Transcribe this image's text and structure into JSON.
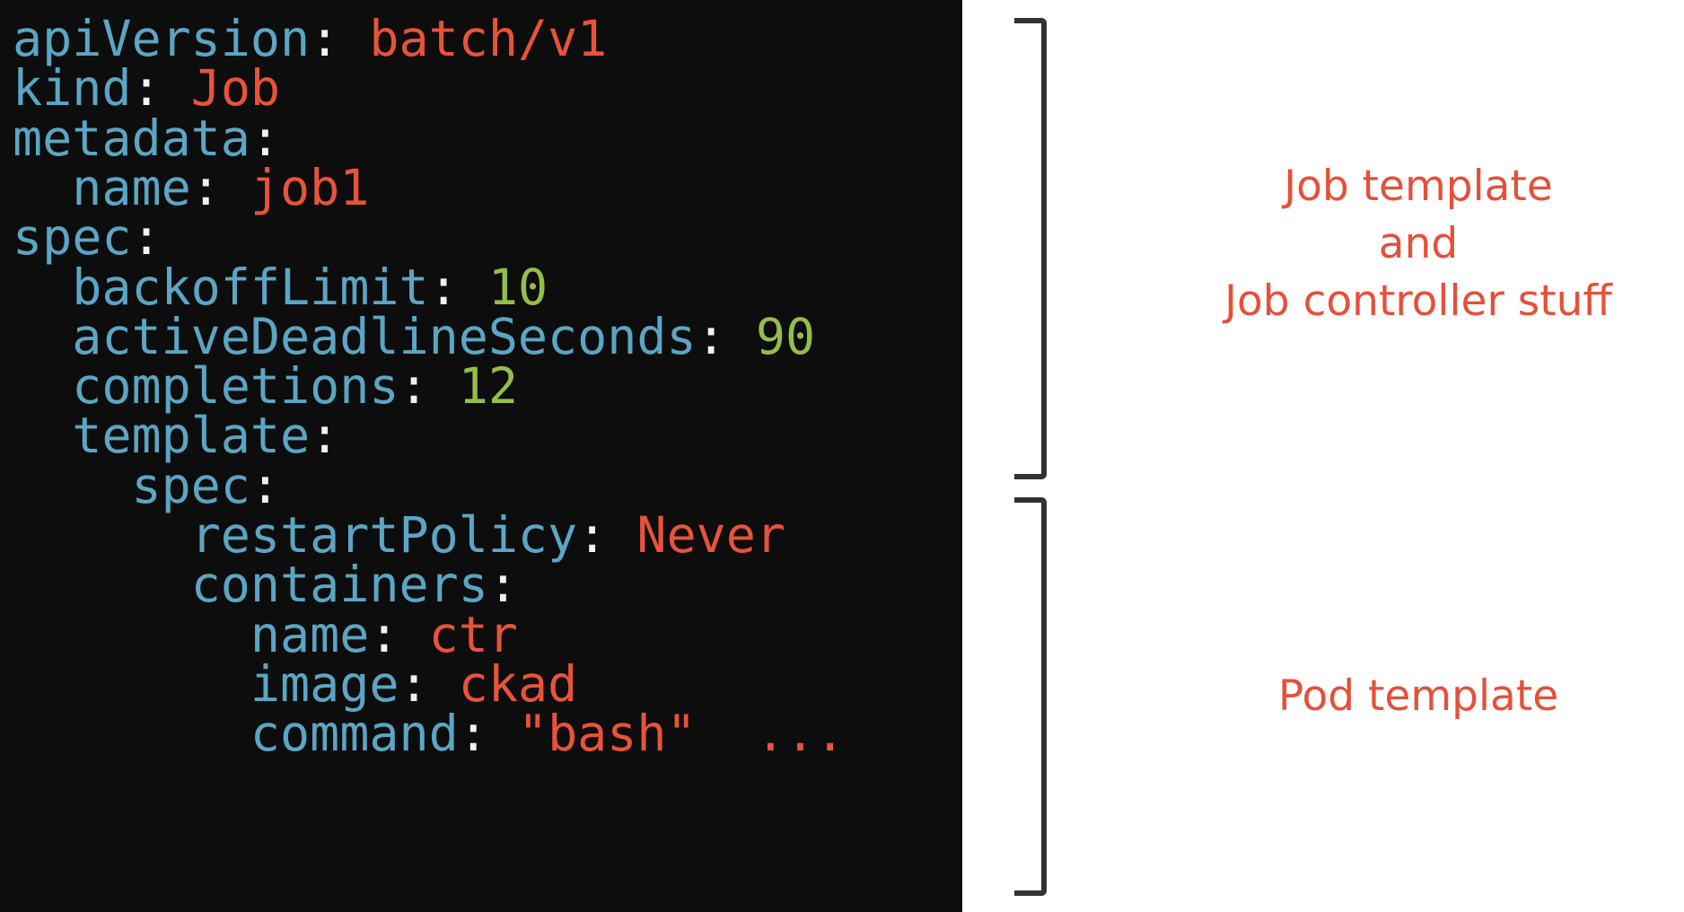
{
  "code": {
    "lines": [
      {
        "indent": "",
        "key": "apiVersion",
        "colon": ":",
        "sep": " ",
        "value": "batch/v1",
        "value_type": "string",
        "trail": ""
      },
      {
        "indent": "",
        "key": "kind",
        "colon": ":",
        "sep": " ",
        "value": "Job",
        "value_type": "string",
        "trail": ""
      },
      {
        "indent": "",
        "key": "metadata",
        "colon": ":",
        "sep": "",
        "value": "",
        "value_type": "none",
        "trail": ""
      },
      {
        "indent": "  ",
        "key": "name",
        "colon": ":",
        "sep": " ",
        "value": "job1",
        "value_type": "string",
        "trail": ""
      },
      {
        "indent": "",
        "key": "spec",
        "colon": ":",
        "sep": "",
        "value": "",
        "value_type": "none",
        "trail": ""
      },
      {
        "indent": "  ",
        "key": "backoffLimit",
        "colon": ":",
        "sep": " ",
        "value": "10",
        "value_type": "number",
        "trail": ""
      },
      {
        "indent": "  ",
        "key": "activeDeadlineSeconds",
        "colon": ":",
        "sep": " ",
        "value": "90",
        "value_type": "number",
        "trail": ""
      },
      {
        "indent": "  ",
        "key": "completions",
        "colon": ":",
        "sep": " ",
        "value": "12",
        "value_type": "number",
        "trail": ""
      },
      {
        "indent": "  ",
        "key": "template",
        "colon": ":",
        "sep": "",
        "value": "",
        "value_type": "none",
        "trail": ""
      },
      {
        "indent": "    ",
        "key": "spec",
        "colon": ":",
        "sep": "",
        "value": "",
        "value_type": "none",
        "trail": ""
      },
      {
        "indent": "      ",
        "key": "restartPolicy",
        "colon": ":",
        "sep": " ",
        "value": "Never",
        "value_type": "string",
        "trail": ""
      },
      {
        "indent": "      ",
        "key": "containers",
        "colon": ":",
        "sep": "",
        "value": "",
        "value_type": "none",
        "trail": ""
      },
      {
        "indent": "        ",
        "key": "name",
        "colon": ":",
        "sep": " ",
        "value": "ctr",
        "value_type": "string",
        "trail": ""
      },
      {
        "indent": "        ",
        "key": "image",
        "colon": ":",
        "sep": " ",
        "value": "ckad",
        "value_type": "string",
        "trail": ""
      },
      {
        "indent": "        ",
        "key": "command",
        "colon": ":",
        "sep": " ",
        "value": "\"bash\"",
        "value_type": "string",
        "trail": "  ..."
      }
    ]
  },
  "annotations": {
    "job": {
      "lines": [
        "Job template",
        "and",
        "Job controller stuff"
      ]
    },
    "pod": {
      "lines": [
        "Pod template"
      ]
    }
  },
  "colors": {
    "background_code": "#0d0d0d",
    "key": "#5aa6c4",
    "punctuation": "#f2f2f2",
    "string_value": "#e8533a",
    "number_value": "#94bd4a",
    "annotation": "#e5503a",
    "bracket": "#333333"
  }
}
